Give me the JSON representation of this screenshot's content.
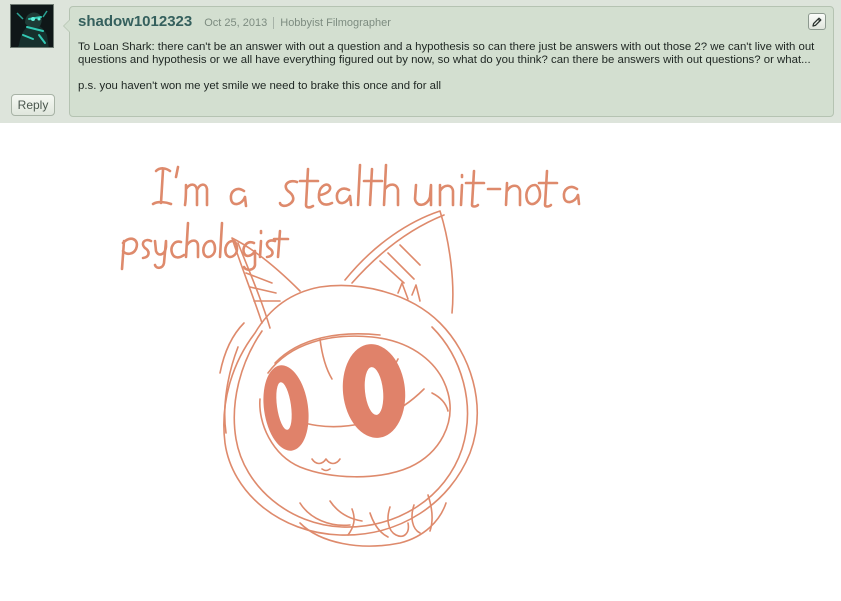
{
  "comment": {
    "username": "shadow1012323",
    "date": "Oct 25, 2013",
    "user_title": "Hobbyist Filmographer",
    "body_1": "To Loan Shark: there can't be an answer with out a question and a hypothesis so can there just be answers with out those 2? we can't live with out questions and hypothesis or we all have everything figured out by now, so what do you think? can there be answers with out questions? or what...",
    "body_2": "p.s. you haven't won me yet smile we need to brake this once and for all",
    "reply_label": "Reply",
    "edit_icon": "pencil-icon",
    "avatar_icon": "user-avatar"
  },
  "drawing": {
    "line_1": "I'm a stealth unit - not a",
    "line_2": "psychologist",
    "ink_color": "#de8a6c",
    "fill_color": "#e0826a"
  }
}
